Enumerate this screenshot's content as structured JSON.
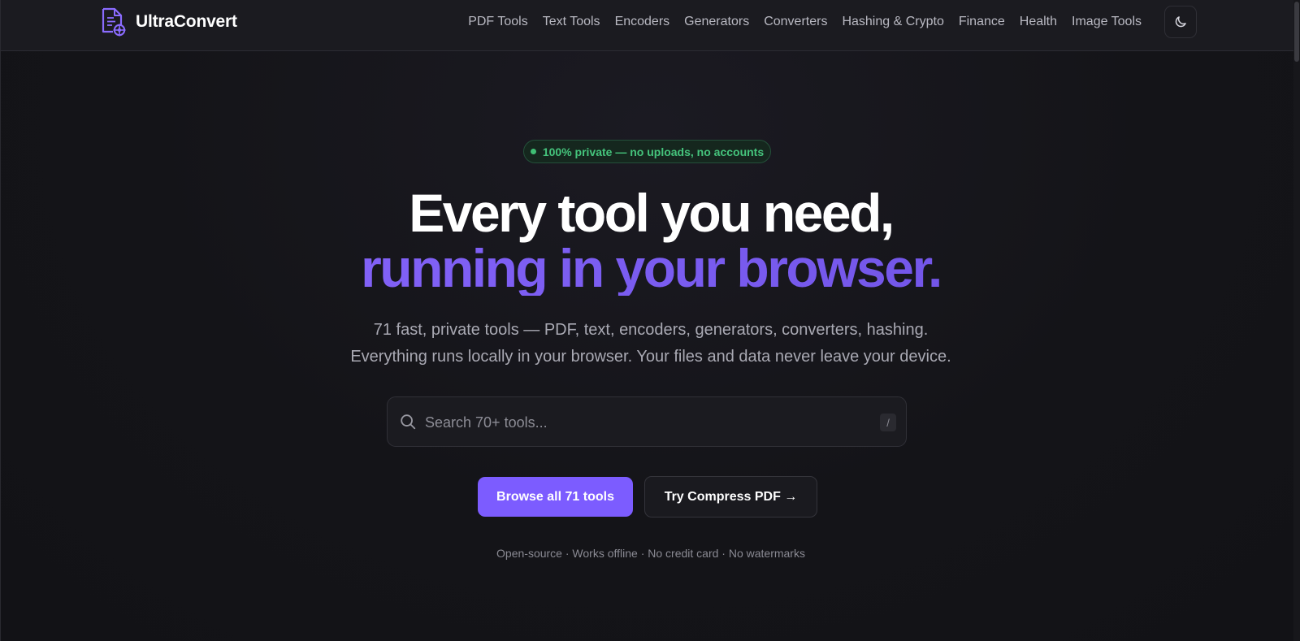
{
  "header": {
    "brand_name": "UltraConvert",
    "brand_icon": "document-gear-icon",
    "nav": [
      {
        "label": "PDF Tools"
      },
      {
        "label": "Text Tools"
      },
      {
        "label": "Encoders"
      },
      {
        "label": "Generators"
      },
      {
        "label": "Converters"
      },
      {
        "label": "Hashing & Crypto"
      },
      {
        "label": "Finance"
      },
      {
        "label": "Health"
      },
      {
        "label": "Image Tools"
      }
    ],
    "theme_toggle_icon": "moon-icon"
  },
  "hero": {
    "badge": "100% private — no uploads, no accounts",
    "title_line1": "Every tool you need,",
    "title_line2": "running in your browser.",
    "subtitle_line1": "71 fast, private tools — PDF, text, encoders, generators, converters, hashing.",
    "subtitle_line2": "Everything runs locally in your browser. Your files and data never leave your device."
  },
  "search": {
    "placeholder": "Search 70+ tools...",
    "value": "",
    "shortcut": "/"
  },
  "buttons": {
    "primary": "Browse all 71 tools",
    "secondary": "Try Compress PDF →"
  },
  "features_line": "Open-source · Works offline · No credit card · No watermarks",
  "colors": {
    "accent": "#7c5cff",
    "badge_green": "#45c47c",
    "background": "#141418"
  }
}
